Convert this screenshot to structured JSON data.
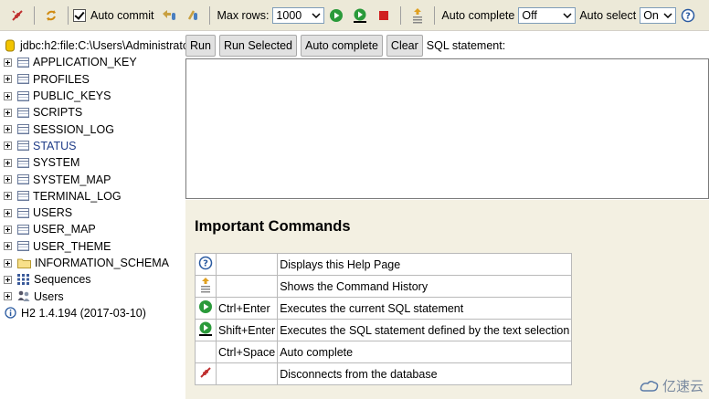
{
  "toolbar": {
    "auto_commit_label": "Auto commit",
    "max_rows_label": "Max rows:",
    "max_rows_value": "1000",
    "auto_complete_label": "Auto complete",
    "auto_complete_value": "Off",
    "auto_select_label": "Auto select",
    "auto_select_value": "On"
  },
  "tree": {
    "connection": "jdbc:h2:file:C:\\Users\\Administrato",
    "tables": [
      "APPLICATION_KEY",
      "PROFILES",
      "PUBLIC_KEYS",
      "SCRIPTS",
      "SESSION_LOG",
      "STATUS",
      "SYSTEM",
      "SYSTEM_MAP",
      "TERMINAL_LOG",
      "USERS",
      "USER_MAP",
      "USER_THEME"
    ],
    "schema": "INFORMATION_SCHEMA",
    "sequences": "Sequences",
    "users": "Users",
    "version": "H2 1.4.194 (2017-03-10)"
  },
  "buttons": {
    "run": "Run",
    "run_selected": "Run Selected",
    "auto_complete": "Auto complete",
    "clear": "Clear",
    "sql_label": "SQL statement:"
  },
  "help": {
    "title": "Important Commands",
    "rows": [
      {
        "icon": "help-icon",
        "key": "",
        "desc": "Displays this Help Page"
      },
      {
        "icon": "history-icon",
        "key": "",
        "desc": "Shows the Command History"
      },
      {
        "icon": "run-icon",
        "key": "Ctrl+Enter",
        "desc": "Executes the current SQL statement"
      },
      {
        "icon": "run-selected-icon",
        "key": "Shift+Enter",
        "desc": "Executes the SQL statement defined by the text selection"
      },
      {
        "icon": "",
        "key": "Ctrl+Space",
        "desc": "Auto complete"
      },
      {
        "icon": "disconnect-icon",
        "key": "",
        "desc": "Disconnects from the database"
      }
    ]
  },
  "watermark": "亿速云"
}
